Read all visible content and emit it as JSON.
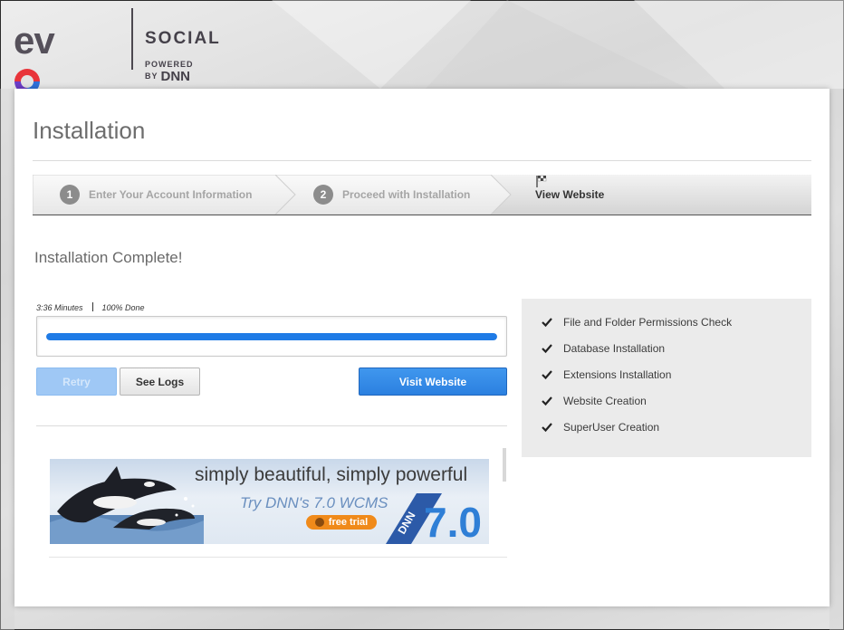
{
  "brand": {
    "product": "evoq",
    "edition": "SOCIAL",
    "powered_by": "POWERED BY",
    "vendor": "DNN"
  },
  "page": {
    "title": "Installation"
  },
  "wizard": {
    "steps": [
      {
        "number": "1",
        "label": "Enter Your Account Information",
        "state": "done"
      },
      {
        "number": "2",
        "label": "Proceed with Installation",
        "state": "done"
      },
      {
        "number": "",
        "label": "View Website",
        "state": "active",
        "icon": "flag-icon"
      }
    ]
  },
  "status": {
    "heading": "Installation Complete!",
    "elapsed": "3:36 Minutes",
    "percent_text": "100% Done",
    "progress": 1.0
  },
  "buttons": {
    "retry": "Retry",
    "see_logs": "See Logs",
    "visit_website": "Visit Website"
  },
  "checklist": [
    {
      "label": "File and Folder Permissions Check",
      "icon": "checkmark-icon"
    },
    {
      "label": "Database Installation",
      "icon": "checkmark-icon"
    },
    {
      "label": "Extensions Installation",
      "icon": "checkmark-icon"
    },
    {
      "label": "Website Creation",
      "icon": "checkmark-icon"
    },
    {
      "label": "SuperUser Creation",
      "icon": "checkmark-icon"
    }
  ],
  "ad": {
    "headline": "simply beautiful, simply powerful",
    "subline": "Try DNN's 7.0 WCMS",
    "cta": "free trial",
    "logo_text": "DNN",
    "version": "7.0"
  },
  "colors": {
    "accent": "#2b80e0",
    "progress": "#1f7be6",
    "retry_disabled": "#9fc8f5",
    "cta": "#f08a1a"
  }
}
